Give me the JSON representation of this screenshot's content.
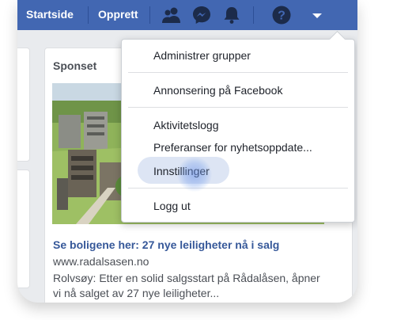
{
  "topbar": {
    "home_label": "Startside",
    "create_label": "Opprett",
    "icons": [
      "friends-icon",
      "messenger-icon",
      "notifications-icon",
      "help-icon",
      "account-menu-caret-icon"
    ],
    "bg_color": "#4267b2"
  },
  "ad": {
    "sponsored_label": "Sponset",
    "title": "Se boligene her: 27 nye leiligheter nå i salg",
    "url": "www.radalsasen.no",
    "body": "Rolvsøy: Etter en solid salgsstart på Rådalåsen, åpner vi nå salget av 27 nye leiligheter..."
  },
  "menu": {
    "items": [
      "Administrer grupper",
      "Annonsering på Facebook",
      "Aktivitetslogg",
      "Preferanser for nyhetsoppdate...",
      "Innstillinger",
      "Logg ut"
    ],
    "highlighted": "Innstillinger"
  }
}
